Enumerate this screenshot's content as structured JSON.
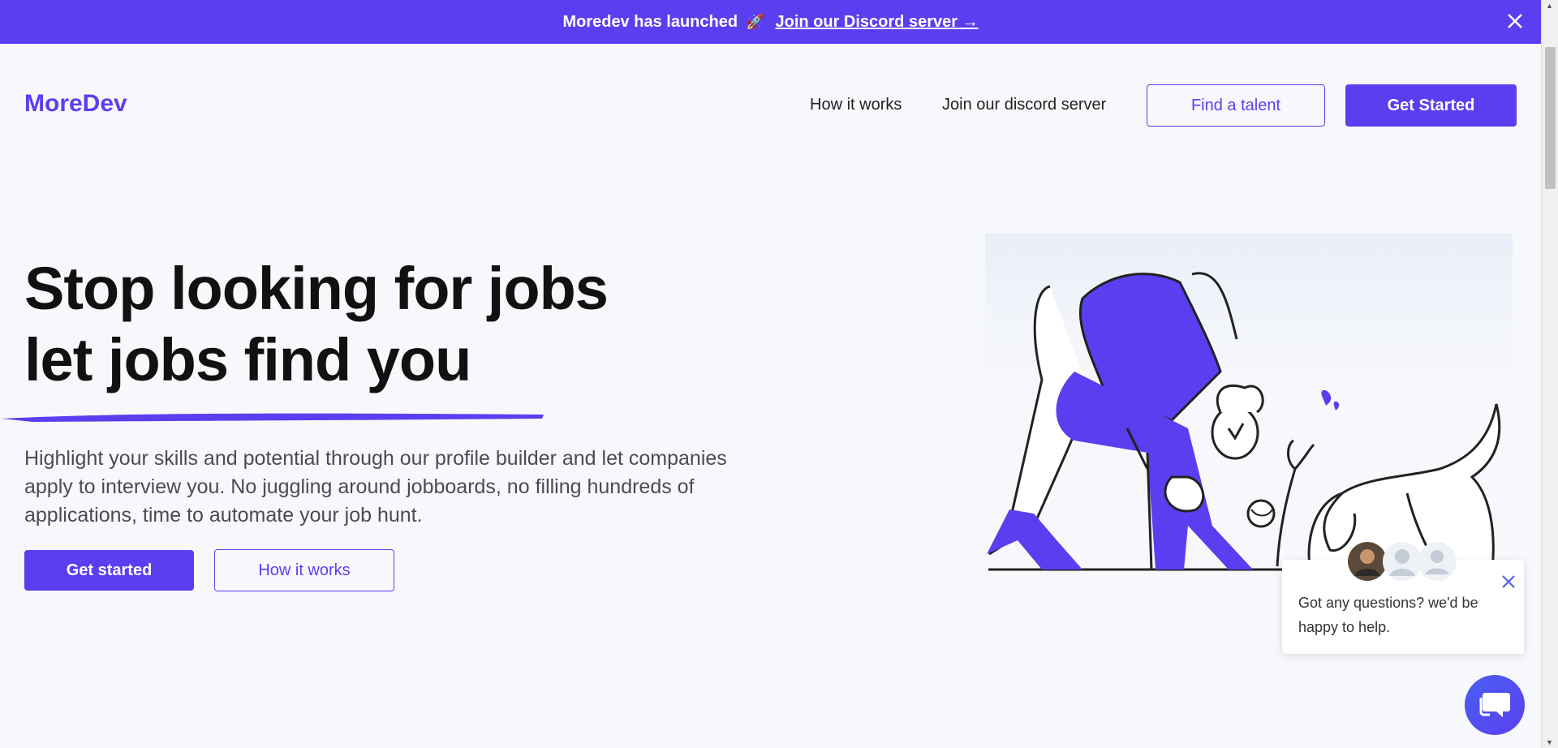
{
  "banner": {
    "text": "Moredev has launched",
    "emoji": "🚀",
    "link_text": "Join our Discord server →"
  },
  "header": {
    "logo": "MoreDev",
    "nav": [
      {
        "label": "How it works"
      },
      {
        "label": "Join our discord server"
      }
    ],
    "find_talent": "Find a talent",
    "get_started": "Get Started"
  },
  "hero": {
    "title_line1": "Stop looking for jobs",
    "title_line2": "let jobs find you",
    "description": "Highlight your skills and potential through our profile builder and let companies apply to interview you. No juggling around jobboards, no filling hundreds of applications, time to automate your job hunt.",
    "cta_primary": "Get started",
    "cta_secondary": "How it works"
  },
  "chat": {
    "message": "Got any questions? we'd be happy to help."
  },
  "colors": {
    "accent": "#5a3ff0",
    "text": "#111111",
    "muted": "#4b4b55",
    "background": "#f7f8fb"
  },
  "icons": [
    "close-icon",
    "rocket-icon",
    "chat-icon",
    "avatar-icon"
  ]
}
